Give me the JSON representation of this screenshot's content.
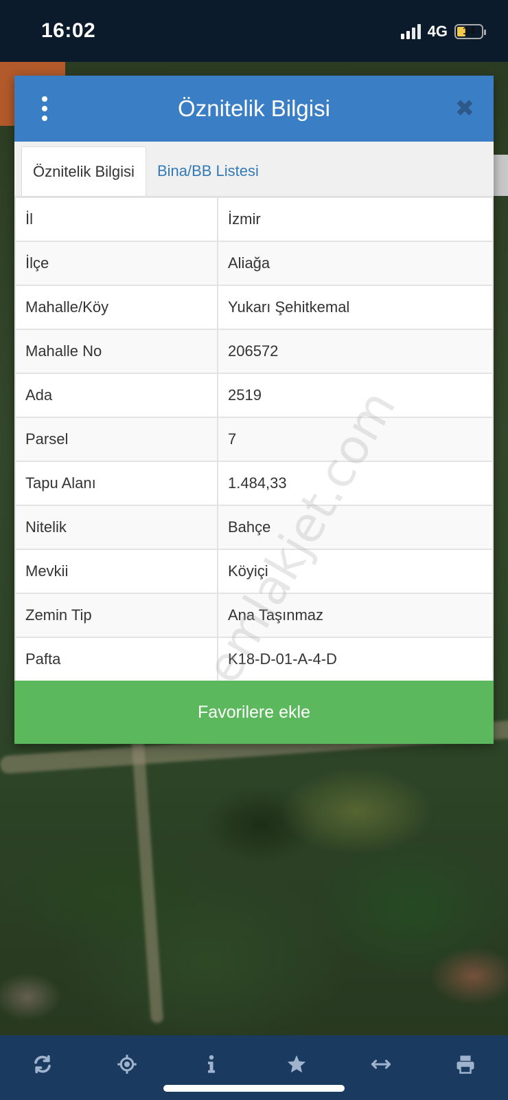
{
  "status_bar": {
    "time": "16:02",
    "network": "4G",
    "battery": "14"
  },
  "modal": {
    "title": "Öznitelik Bilgisi",
    "tabs": [
      {
        "label": "Öznitelik Bilgisi",
        "active": true
      },
      {
        "label": "Bina/BB Listesi",
        "active": false
      }
    ],
    "rows": [
      {
        "key": "İl",
        "value": "İzmir"
      },
      {
        "key": "İlçe",
        "value": "Aliağa"
      },
      {
        "key": "Mahalle/Köy",
        "value": "Yukarı Şehitkemal"
      },
      {
        "key": "Mahalle No",
        "value": "206572"
      },
      {
        "key": "Ada",
        "value": "2519"
      },
      {
        "key": "Parsel",
        "value": "7"
      },
      {
        "key": "Tapu Alanı",
        "value": "1.484,33"
      },
      {
        "key": "Nitelik",
        "value": "Bahçe"
      },
      {
        "key": "Mevkii",
        "value": "Köyiçi"
      },
      {
        "key": "Zemin Tip",
        "value": "Ana Taşınmaz"
      },
      {
        "key": "Pafta",
        "value": "K18-D-01-A-4-D"
      }
    ],
    "favorite_button": "Favorilere ekle"
  },
  "watermark": "emlakjet.com",
  "toolbar": {
    "icons": [
      "refresh-icon",
      "locate-icon",
      "info-icon",
      "star-icon",
      "measure-icon",
      "print-icon"
    ]
  },
  "colors": {
    "header": "#3a7ec5",
    "favorite_button": "#5cb85c",
    "toolbar": "#1a3a60",
    "status_bar": "#0c1b2b"
  }
}
